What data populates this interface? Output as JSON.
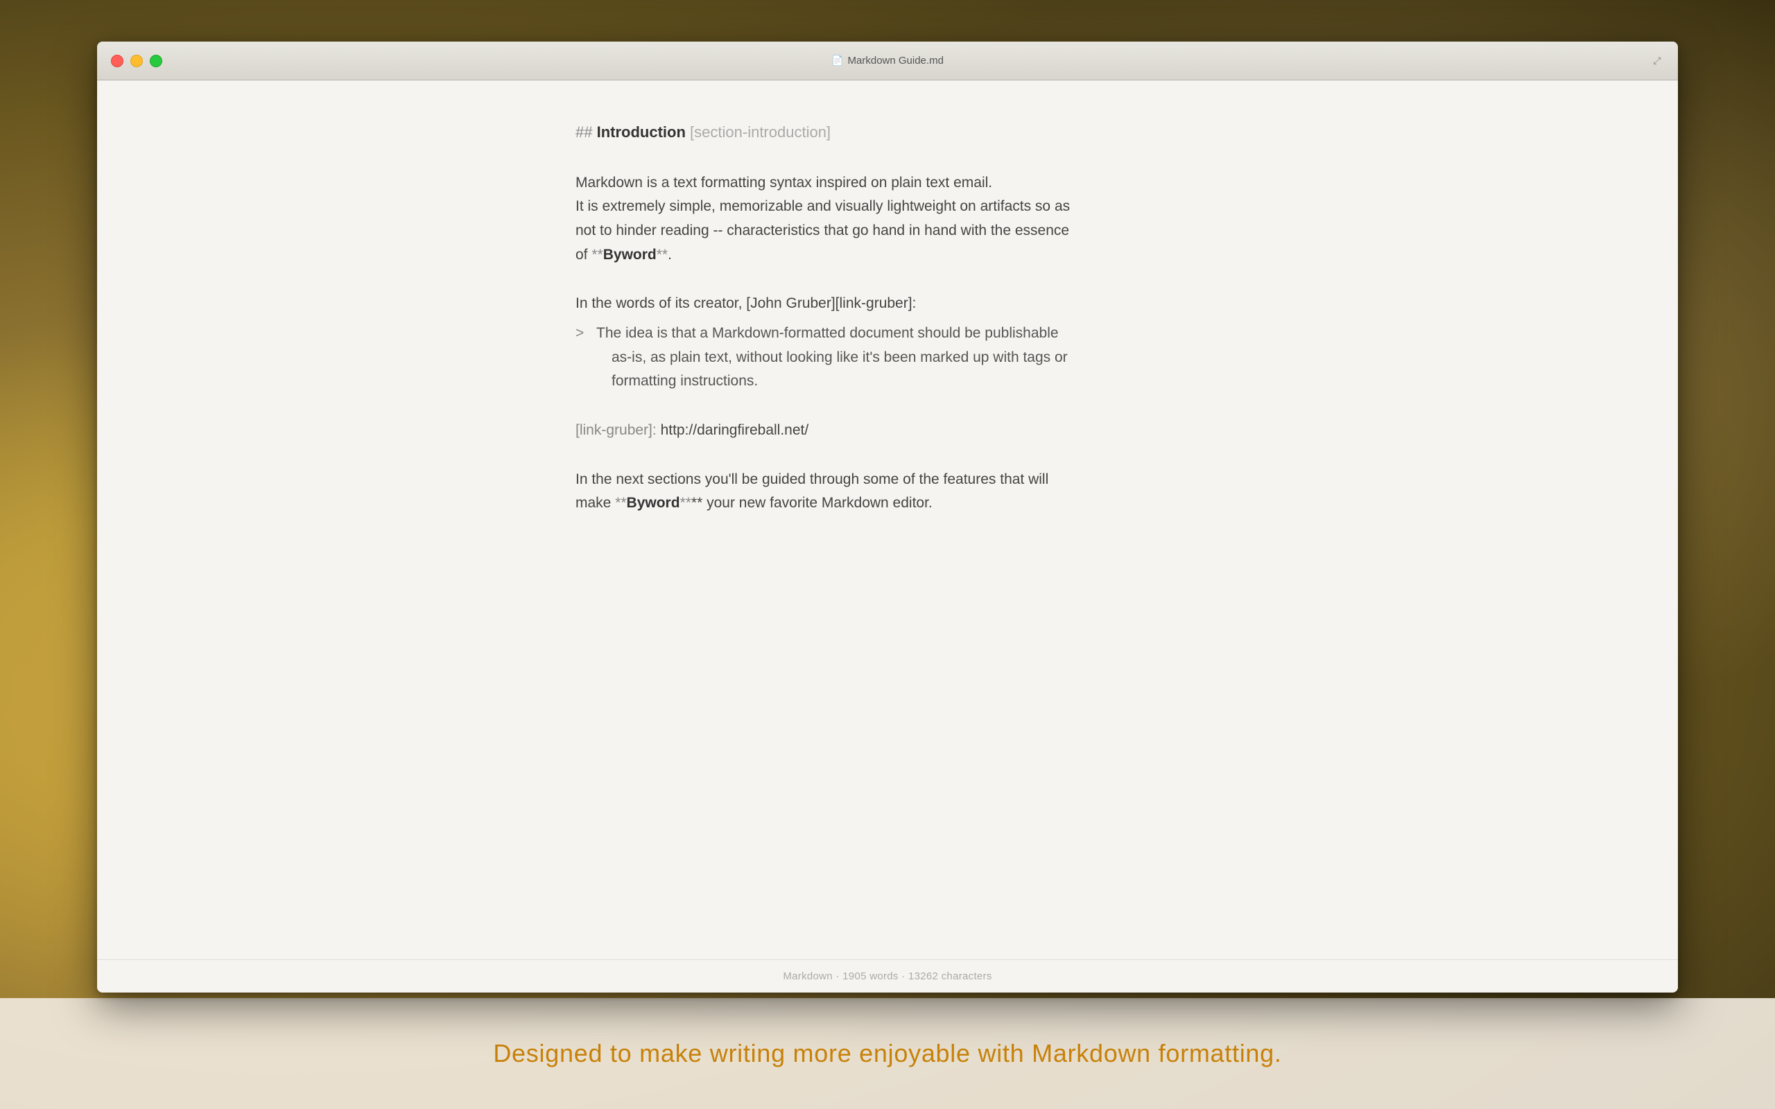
{
  "background": {
    "color_main": "#b89a3a",
    "color_dark": "#4a3e18"
  },
  "bottom_bar": {
    "tagline": "Designed to make writing more enjoyable with Markdown formatting."
  },
  "window": {
    "titlebar": {
      "title": "Markdown Guide.md",
      "icon": "📄",
      "expand_icon": "⤢"
    },
    "traffic_lights": {
      "close_label": "close",
      "minimize_label": "minimize",
      "maximize_label": "maximize"
    },
    "content": {
      "heading": {
        "hash": "##",
        "title": "Introduction",
        "anchor": "[section-introduction]"
      },
      "paragraph1": {
        "line1": "Markdown is a text formatting syntax inspired on plain text email.",
        "line2": "It is extremely simple, memorizable and visually lightweight on artifacts so as",
        "line3": "not to hinder reading -- characteristics that go hand in hand with the essence",
        "line4_pre": "of **",
        "bold": "Byword",
        "line4_post": "**."
      },
      "paragraph2": {
        "pre": "In the words of its creator, [John Gruber][link-gruber]:"
      },
      "quote": {
        "marker": ">",
        "line1": "The idea is that a Markdown-formatted document should be publishable",
        "line2": "as-is, as plain text, without looking like it's been marked up with tags or",
        "line3": "formatting instructions."
      },
      "link_ref": {
        "ref": "[link-gruber]:",
        "url": "http://daringfireball.net/"
      },
      "paragraph3": {
        "line1": "In the next sections you'll be guided through some of the features that will",
        "line2_pre": "make **",
        "bold": "Byword",
        "line2_post": "** your new favorite Markdown editor."
      }
    },
    "statusbar": {
      "text": "Markdown · 1905 words · 13262 characters"
    }
  }
}
